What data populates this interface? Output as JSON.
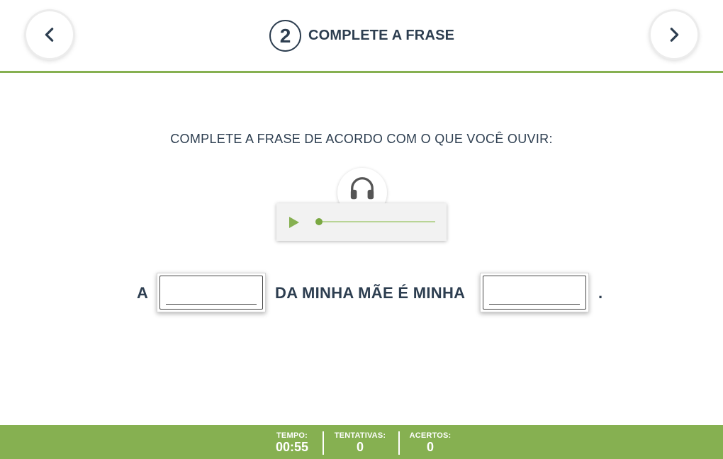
{
  "header": {
    "step_number": "2",
    "title": "COMPLETE A FRASE"
  },
  "instruction": "COMPLETE A FRASE DE ACORDO COM O QUE VOCÊ OUVIR:",
  "audio": {
    "icon": "headphones-icon",
    "progress": 0
  },
  "sentence": {
    "word_1": "A",
    "word_2": "DA MINHA MÃE É MINHA",
    "word_3": ".",
    "blank_1_value": "",
    "blank_2_value": ""
  },
  "footer": {
    "time_label": "TEMPO:",
    "time_value": "00:55",
    "attempts_label": "TENTATIVAS:",
    "attempts_value": "0",
    "hits_label": "ACERTOS:",
    "hits_value": "0"
  },
  "colors": {
    "accent": "#86b051",
    "text": "#2d3e50"
  }
}
